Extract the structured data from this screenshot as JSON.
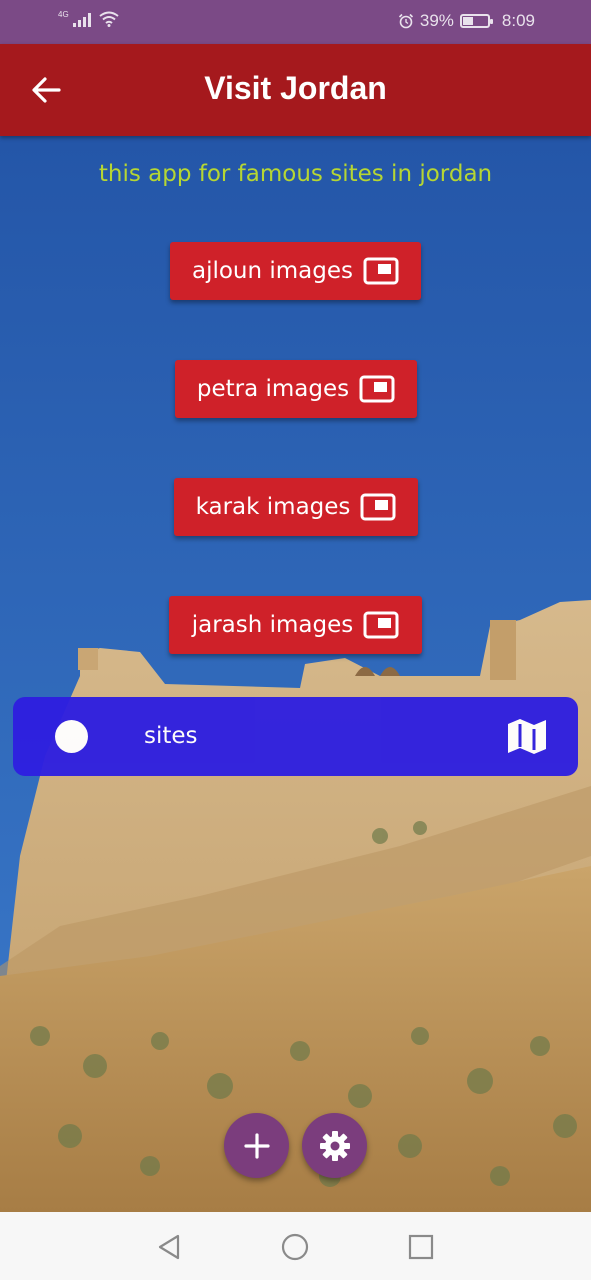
{
  "status_bar": {
    "network": "4G",
    "battery": "39%",
    "battery_level": 0.39,
    "time": "8:09",
    "icons": [
      "signal-icon",
      "wifi-icon",
      "alarm-icon",
      "battery-icon"
    ]
  },
  "app_bar": {
    "title": "Visit Jordan",
    "back_icon": "arrow-left-icon"
  },
  "main": {
    "subtitle": "this app for famous sites in jordan",
    "buttons": [
      {
        "label": "ajloun images",
        "icon": "picture-in-picture-icon"
      },
      {
        "label": "petra images",
        "icon": "picture-in-picture-icon"
      },
      {
        "label": "karak images",
        "icon": "picture-in-picture-icon"
      },
      {
        "label": "jarash images",
        "icon": "picture-in-picture-icon"
      }
    ],
    "switch_tile": {
      "label": "sites",
      "state": "off",
      "icon": "map-icon"
    }
  },
  "fabs": [
    {
      "icon": "plus-icon"
    },
    {
      "icon": "settings-icon"
    }
  ],
  "nav_bar": {
    "icons": [
      "back-triangle-icon",
      "home-circle-icon",
      "recents-square-icon"
    ]
  },
  "colors": {
    "status_bar": "#7b4a86",
    "app_bar": "#a5191d",
    "button": "#cf2129",
    "subtitle": "#b6d633",
    "switch_tile": "#2e1fe0",
    "fab": "#7b3d7d",
    "sky": "#2f66b5"
  }
}
